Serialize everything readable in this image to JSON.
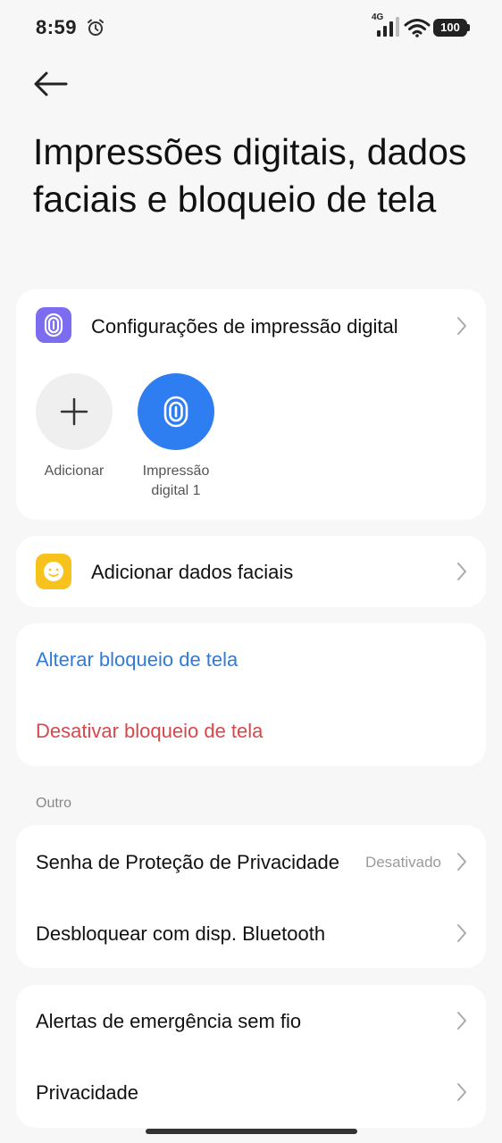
{
  "status_bar": {
    "time": "8:59",
    "network": "4G",
    "battery": "100"
  },
  "header": {
    "title": "Impressões digitais, dados faciais e bloqueio de tela"
  },
  "fingerprint_card": {
    "settings_label": "Configurações de impressão digital",
    "add_label": "Adicionar",
    "fingerprints": [
      {
        "line1": "Impressão",
        "line2": "digital 1"
      }
    ],
    "icon_color": "#7b6cf0",
    "fingerprint_color": "#2f7ef1"
  },
  "face_card": {
    "label": "Adicionar dados faciais",
    "icon_color": "#f7c21c"
  },
  "lock_card": {
    "change_label": "Alterar bloqueio de tela",
    "disable_label": "Desativar bloqueio de tela",
    "change_color": "#2f7bd9",
    "disable_color": "#d9474a"
  },
  "other_section": {
    "title": "Outro",
    "items": [
      {
        "label": "Senha de Proteção de Privacidade",
        "value": "Desativado"
      },
      {
        "label": "Desbloquear com disp. Bluetooth"
      }
    ]
  },
  "more_section": {
    "items": [
      {
        "label": "Alertas de emergência sem fio"
      },
      {
        "label": "Privacidade"
      }
    ]
  }
}
